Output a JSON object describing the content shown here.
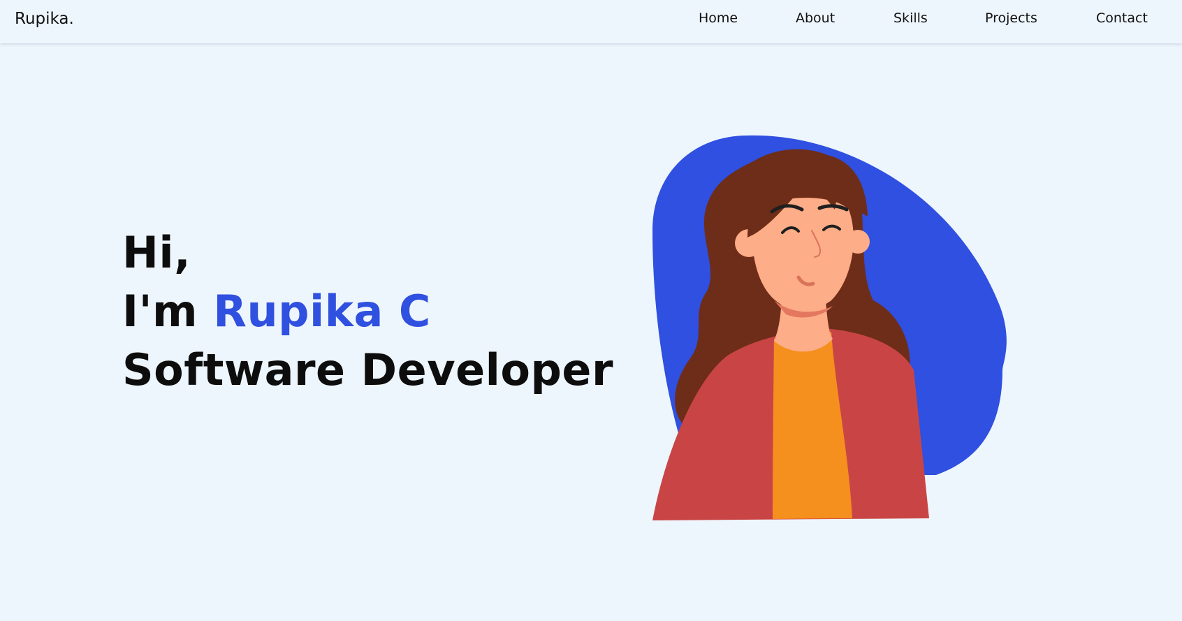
{
  "header": {
    "logo": "Rupika.",
    "nav": [
      {
        "label": "Home"
      },
      {
        "label": "About"
      },
      {
        "label": "Skills"
      },
      {
        "label": "Projects"
      },
      {
        "label": "Contact"
      }
    ]
  },
  "hero": {
    "greeting": "Hi,",
    "intro_prefix": "I'm",
    "name": "Rupika C",
    "role": "Software Developer"
  },
  "illustration": {
    "icon": "person-avatar-illustration",
    "colors": {
      "blob": "#2f50e0",
      "hair": "#6e2d18",
      "skin": "#fdad88",
      "jacket": "#c94545",
      "shirt": "#f58f1d"
    }
  },
  "colors": {
    "background": "#eef6fd",
    "accent": "#3050df"
  }
}
